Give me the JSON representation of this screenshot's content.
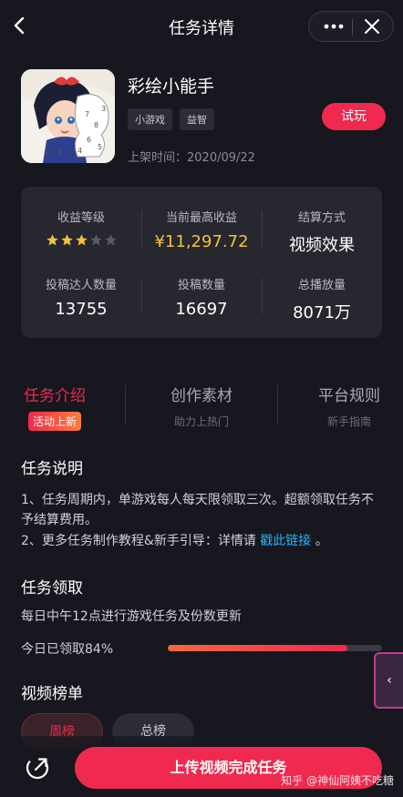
{
  "header": {
    "title": "任务详情"
  },
  "game": {
    "name": "彩绘小能手",
    "tags": [
      "小游戏",
      "益智"
    ],
    "try_label": "试玩",
    "release_date": "上架时间：2020/09/22"
  },
  "stats": {
    "income_level": {
      "label": "收益等级",
      "stars_filled": 3,
      "stars_total": 5
    },
    "max_income": {
      "label": "当前最高收益",
      "value": "¥11,297.72"
    },
    "settlement": {
      "label": "结算方式",
      "value": "视频效果"
    },
    "creators": {
      "label": "投稿达人数量",
      "value": "13755"
    },
    "submissions": {
      "label": "投稿数量",
      "value": "16697"
    },
    "plays": {
      "label": "总播放量",
      "value": "8071万"
    }
  },
  "tabs": [
    {
      "label": "任务介绍",
      "badge": "活动上新"
    },
    {
      "label": "创作素材",
      "sub": "助力上热门"
    },
    {
      "label": "平台规则",
      "sub": "新手指南"
    }
  ],
  "description": {
    "title": "任务说明",
    "line1": "1、任务周期内，单游戏每人每天限领取三次。超额领取任务不予结算费用。",
    "line2_prefix": "2、更多任务制作教程&新手引导：详情请 ",
    "line2_link": "戳此链接",
    "line2_suffix": " 。"
  },
  "claim": {
    "title": "任务领取",
    "note": "每日中午12点进行游戏任务及份数更新",
    "progress_text": "今日已领取84%",
    "progress_percent": 84
  },
  "ranking": {
    "title": "视频榜单",
    "tabs": [
      "周榜",
      "总榜"
    ]
  },
  "bottom": {
    "upload_label": "上传视频完成任务",
    "watermark": "知乎 @神仙阿姨不吃糖",
    "side_handle": "‹"
  },
  "colors": {
    "accent": "#f0294f",
    "gold": "#f5c23b",
    "link": "#29b6f6",
    "background": "#16171f",
    "card": "#26272f"
  }
}
